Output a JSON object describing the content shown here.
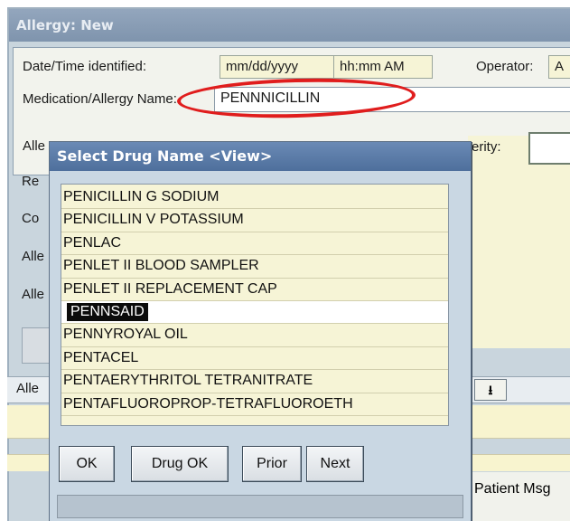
{
  "allergy_window": {
    "title": "Allergy: New",
    "date_time_label": "Date/Time identified:",
    "date_value": "mm/dd/yyyy",
    "time_value": "hh:mm AM",
    "operator_label": "Operator:",
    "operator_value": "A",
    "medication_label": "Medication/Allergy Name:",
    "medication_value": "PENNNICILLIN",
    "truncated_labels": [
      "Alle",
      "Re",
      "Co",
      "Alle",
      "Alle"
    ],
    "severity_label": "erity:",
    "lower_tab_label": "Alle",
    "dropdown_arrow": "⭳",
    "patient_msg": "Patient Msg"
  },
  "dialog": {
    "title": "Select Drug Name  <View>",
    "drugs": [
      "PENICILLIN G SODIUM",
      "PENICILLIN V POTASSIUM",
      "PENLAC",
      "PENLET II BLOOD SAMPLER",
      "PENLET II REPLACEMENT CAP",
      "PENNSAID",
      "PENNYROYAL OIL",
      "PENTACEL",
      "PENTAERYTHRITOL TETRANITRATE",
      "PENTAFLUOROPROP-TETRAFLUOROETH"
    ],
    "selected_index": 5,
    "buttons": {
      "ok": "OK",
      "drug_ok": "Drug OK",
      "prior": "Prior",
      "next": "Next"
    }
  },
  "colors": {
    "highlight": "#e01d1d",
    "dialog_title_bg": "#4e6f9c",
    "list_bg": "#f6f4d6"
  }
}
